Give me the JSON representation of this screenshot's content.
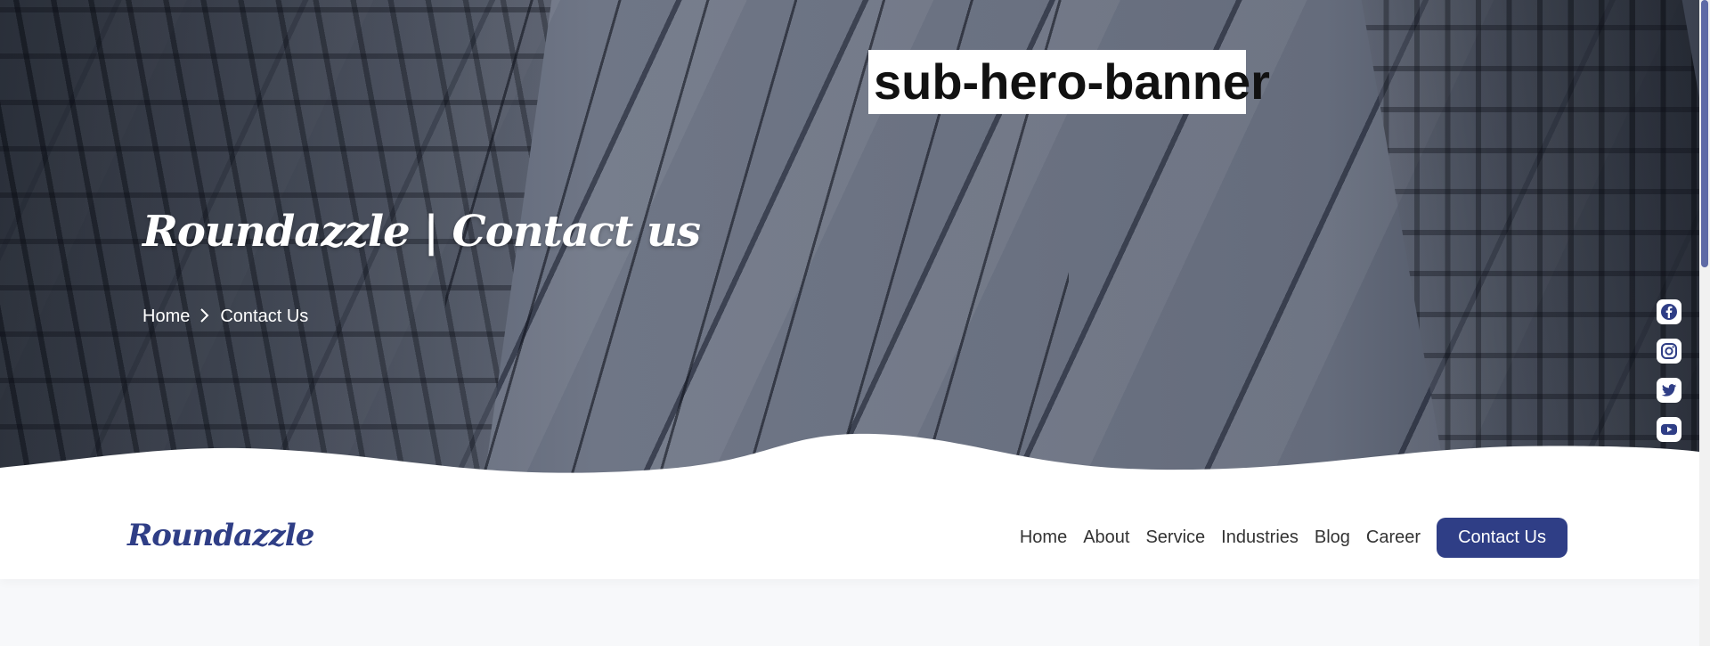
{
  "overlay_label": "sub-hero-banner",
  "hero": {
    "title": "Roundazzle | Contact us",
    "breadcrumb": {
      "home": "Home",
      "current": "Contact Us"
    }
  },
  "social": [
    {
      "name": "facebook-icon"
    },
    {
      "name": "instagram-icon"
    },
    {
      "name": "twitter-icon"
    },
    {
      "name": "youtube-icon"
    }
  ],
  "navbar": {
    "logo": "Roundazzle",
    "links": [
      "Home",
      "About",
      "Service",
      "Industries",
      "Blog",
      "Career"
    ],
    "cta": "Contact Us"
  },
  "colors": {
    "brand": "#2f3e86",
    "white": "#ffffff",
    "text": "#333333"
  }
}
